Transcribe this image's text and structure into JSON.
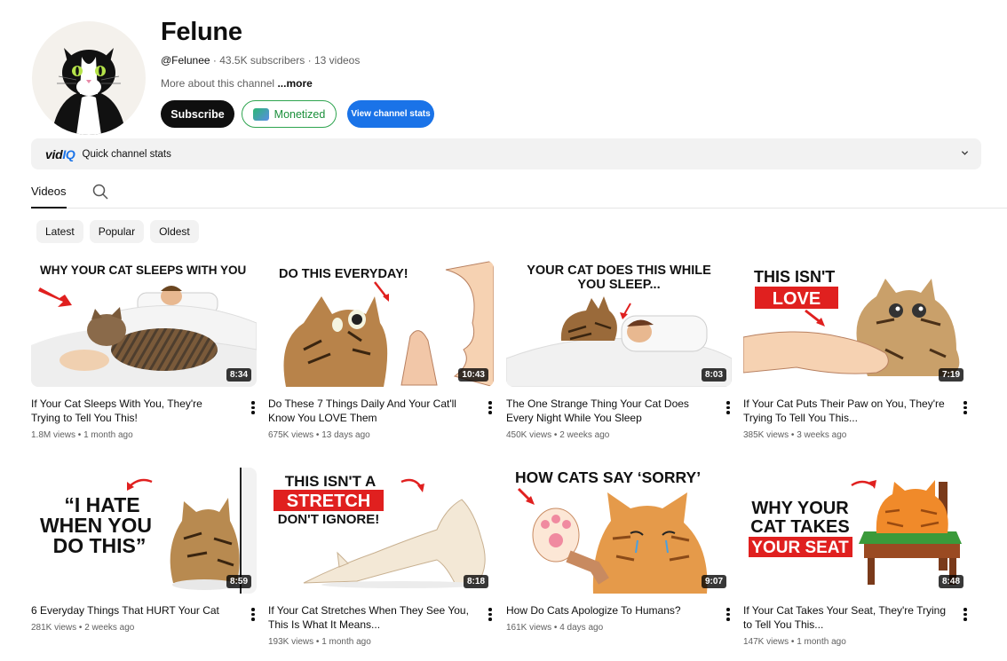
{
  "channel": {
    "name": "Felune",
    "handle": "@Felunee",
    "subscribers": "43.5K subscribers",
    "video_count": "13 videos",
    "about": "More about this channel",
    "more_link": "...more"
  },
  "buttons": {
    "subscribe": "Subscribe",
    "monetized": "Monetized",
    "view_stats": "View channel stats"
  },
  "vidiq": {
    "logo_vid": "vid",
    "logo_iq": "IQ",
    "label": "Quick channel stats"
  },
  "tabs": {
    "videos": "Videos"
  },
  "chips": [
    "Latest",
    "Popular",
    "Oldest"
  ],
  "colors": {
    "subscribe_bg": "#0f0f0f",
    "monetized": "#2ea44f",
    "stats_btn": "#1a73e8",
    "thumb_red": "#e0201f"
  },
  "videos": [
    {
      "thumb_lines": [
        "WHY YOUR CAT SLEEPS WITH YOU"
      ],
      "duration": "8:34",
      "title": "If Your Cat Sleeps With You, They're Trying to Tell You This!",
      "views": "1.8M views",
      "age": "1 month ago"
    },
    {
      "thumb_lines": [
        "DO THIS EVERYDAY!"
      ],
      "duration": "10:43",
      "title": "Do These 7 Things Daily And Your Cat'll Know You LOVE Them",
      "views": "675K views",
      "age": "13 days ago"
    },
    {
      "thumb_lines": [
        "YOUR CAT DOES THIS WHILE",
        "YOU SLEEP..."
      ],
      "duration": "8:03",
      "title": "The One Strange Thing Your Cat Does Every Night While You Sleep",
      "views": "450K views",
      "age": "2 weeks ago"
    },
    {
      "thumb_lines": [
        "THIS ISN'T",
        "LOVE"
      ],
      "duration": "7:19",
      "title": "If Your Cat Puts Their Paw on You, They're Trying To Tell You This...",
      "views": "385K views",
      "age": "3 weeks ago"
    },
    {
      "thumb_lines": [
        "“I HATE",
        "WHEN YOU",
        "DO THIS”"
      ],
      "duration": "8:59",
      "title": "6 Everyday Things That HURT Your Cat",
      "views": "281K views",
      "age": "2 weeks ago"
    },
    {
      "thumb_lines": [
        "THIS ISN'T A",
        "STRETCH",
        "DON'T IGNORE!"
      ],
      "duration": "8:18",
      "title": "If Your Cat Stretches When They See You, This Is What It Means...",
      "views": "193K views",
      "age": "1 month ago"
    },
    {
      "thumb_lines": [
        "HOW CATS SAY ‘SORRY’"
      ],
      "duration": "9:07",
      "title": "How Do Cats Apologize To Humans?",
      "views": "161K views",
      "age": "4 days ago"
    },
    {
      "thumb_lines": [
        "WHY YOUR",
        "CAT TAKES",
        "YOUR SEAT"
      ],
      "duration": "8:48",
      "title": "If Your Cat Takes Your Seat, They're Trying to Tell You This...",
      "views": "147K views",
      "age": "1 month ago"
    }
  ]
}
